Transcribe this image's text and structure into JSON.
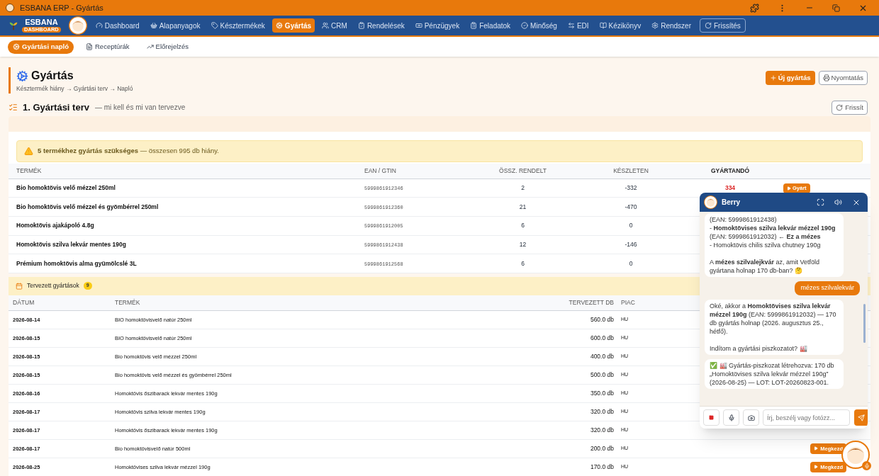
{
  "window": {
    "title": "ESBANA ERP - Gyártás"
  },
  "nav": {
    "brand": "ESBANA",
    "brand_badge": "DASHBOARD",
    "refresh": "Frissítés",
    "items": [
      {
        "label": "Dashboard",
        "selected": false
      },
      {
        "label": "Alapanyagok",
        "selected": false
      },
      {
        "label": "Késztermékek",
        "selected": false
      },
      {
        "label": "Gyártás",
        "selected": true
      },
      {
        "label": "CRM",
        "selected": false
      },
      {
        "label": "Rendelések",
        "selected": false
      },
      {
        "label": "Pénzügyek",
        "selected": false
      },
      {
        "label": "Feladatok",
        "selected": false
      },
      {
        "label": "Minőség",
        "selected": false
      },
      {
        "label": "EDI",
        "selected": false
      },
      {
        "label": "Kézikönyv",
        "selected": false
      },
      {
        "label": "Rendszer",
        "selected": false
      }
    ]
  },
  "subnav": {
    "items": [
      {
        "label": "Gyártási napló",
        "selected": true
      },
      {
        "label": "Receptúrák",
        "selected": false
      },
      {
        "label": "Előrejelzés",
        "selected": false
      }
    ]
  },
  "header": {
    "title": "Gyártás",
    "breadcrumb": "Késztermék hiány → Gyártási terv → Napló",
    "new_button": "Új gyártás",
    "print_button": "Nyomtatás"
  },
  "section": {
    "title": "1. Gyártási terv",
    "subtitle": "— mi kell és mi van tervezve",
    "refresh_button": "Frissít"
  },
  "alert": {
    "text": "**5 termékhez gyártás szükséges** — összesen 995 db hiány."
  },
  "shortage_table": {
    "columns": [
      "TERMÉK",
      "EAN / GTIN",
      "ÖSSZ. RENDELT",
      "KÉSZLETEN",
      "GYÁRTANDÓ"
    ],
    "rows": [
      {
        "product": "Bio homoktövis velő mézzel 250ml",
        "ean": "5999861912346",
        "ordered": "2",
        "stock": "-332",
        "to_produce": "334",
        "action": "Gyárt"
      },
      {
        "product": "Bio homoktövis velő mézzel és gyömbérrel 250ml",
        "ean": "5999861912360",
        "ordered": "21",
        "stock": "-470"
      },
      {
        "product": "Homoktövis ajakápoló 4.8g",
        "ean": "5999861912005",
        "ordered": "6",
        "stock": "0"
      },
      {
        "product": "Homoktövis szilva lekvár mentes 190g",
        "ean": "5999861912438",
        "ordered": "12",
        "stock": "-146"
      },
      {
        "product": "Prémium homoktövis alma gyümölcslé 3L",
        "ean": "5999861912568",
        "ordered": "6",
        "stock": "0"
      }
    ]
  },
  "planned": {
    "title": "Tervezett gyártások",
    "count": "9",
    "columns": [
      "DÁTUM",
      "TERMÉK",
      "TERVEZETT DB",
      "PIAC"
    ],
    "rows": [
      {
        "date": "2026-08-14",
        "product": "BIO homoktövisvelő natúr 250ml",
        "qty": "560.0 db",
        "market": "HU"
      },
      {
        "date": "2026-08-15",
        "product": "BIO homoktövisvelő natúr 250ml",
        "qty": "600.0 db",
        "market": "HU"
      },
      {
        "date": "2026-08-15",
        "product": "Bio homoktövis velő mézzel 250ml",
        "qty": "400.0 db",
        "market": "HU"
      },
      {
        "date": "2026-08-15",
        "product": "Bio homoktövis velő mézzel és gyömbérrel 250ml",
        "qty": "500.0 db",
        "market": "HU"
      },
      {
        "date": "2026-08-16",
        "product": "Homoktövis őszibarack lekvár mentes 190g",
        "qty": "350.0 db",
        "market": "HU"
      },
      {
        "date": "2026-08-17",
        "product": "Homoktövis szilva lekvár mentes 190g",
        "qty": "320.0 db",
        "market": "HU"
      },
      {
        "date": "2026-08-17",
        "product": "Homoktövis őszibarack lekvár mentes 190g",
        "qty": "320.0 db",
        "market": "HU"
      },
      {
        "date": "2026-08-17",
        "product": "Bio homoktövisvelő natúr 500ml",
        "qty": "200.0 db",
        "market": "HU",
        "action": "Megkezd"
      },
      {
        "date": "2026-08-25",
        "product": "Homoktövises szilva lekvár mézzel 190g",
        "qty": "170.0 db",
        "market": "HU",
        "action": "Megkezd"
      }
    ]
  },
  "chat": {
    "title": "Berry",
    "placeholder": "Írj, beszélj vagy fotózz...",
    "messages": [
      {
        "kind": "bot",
        "text": "(EAN: 5999861912438)\n- **Homoktövises szilva lekvár mézzel 190g** (EAN: 5999861912032) ← **Ez a mézes**\n- Homoktövis chilis szilva chutney 190g\n\nA **mézes szilvalejkvár** az, amit Vetföld gyártana holnap 170 db-ban? 🤔"
      },
      {
        "kind": "user",
        "text": "mézes szilvalekvár"
      },
      {
        "kind": "bot",
        "text": "Oké, akkor a **Homoktövises szilva lekvár mézzel 190g** (EAN: 5999861912032) — 170 db gyártás holnap (2026. augusztus 25., hétfő).\n\nIndítom a gyártási piszkozatot? 🏭"
      },
      {
        "kind": "bot",
        "text": "✅ 🏭 Gyártás-piszkozat létrehozva: 170 db „Homoktövises szilva lekvár mézzel 190g” (2026-08-25) — LOT: LOT-20260823-001."
      }
    ]
  }
}
